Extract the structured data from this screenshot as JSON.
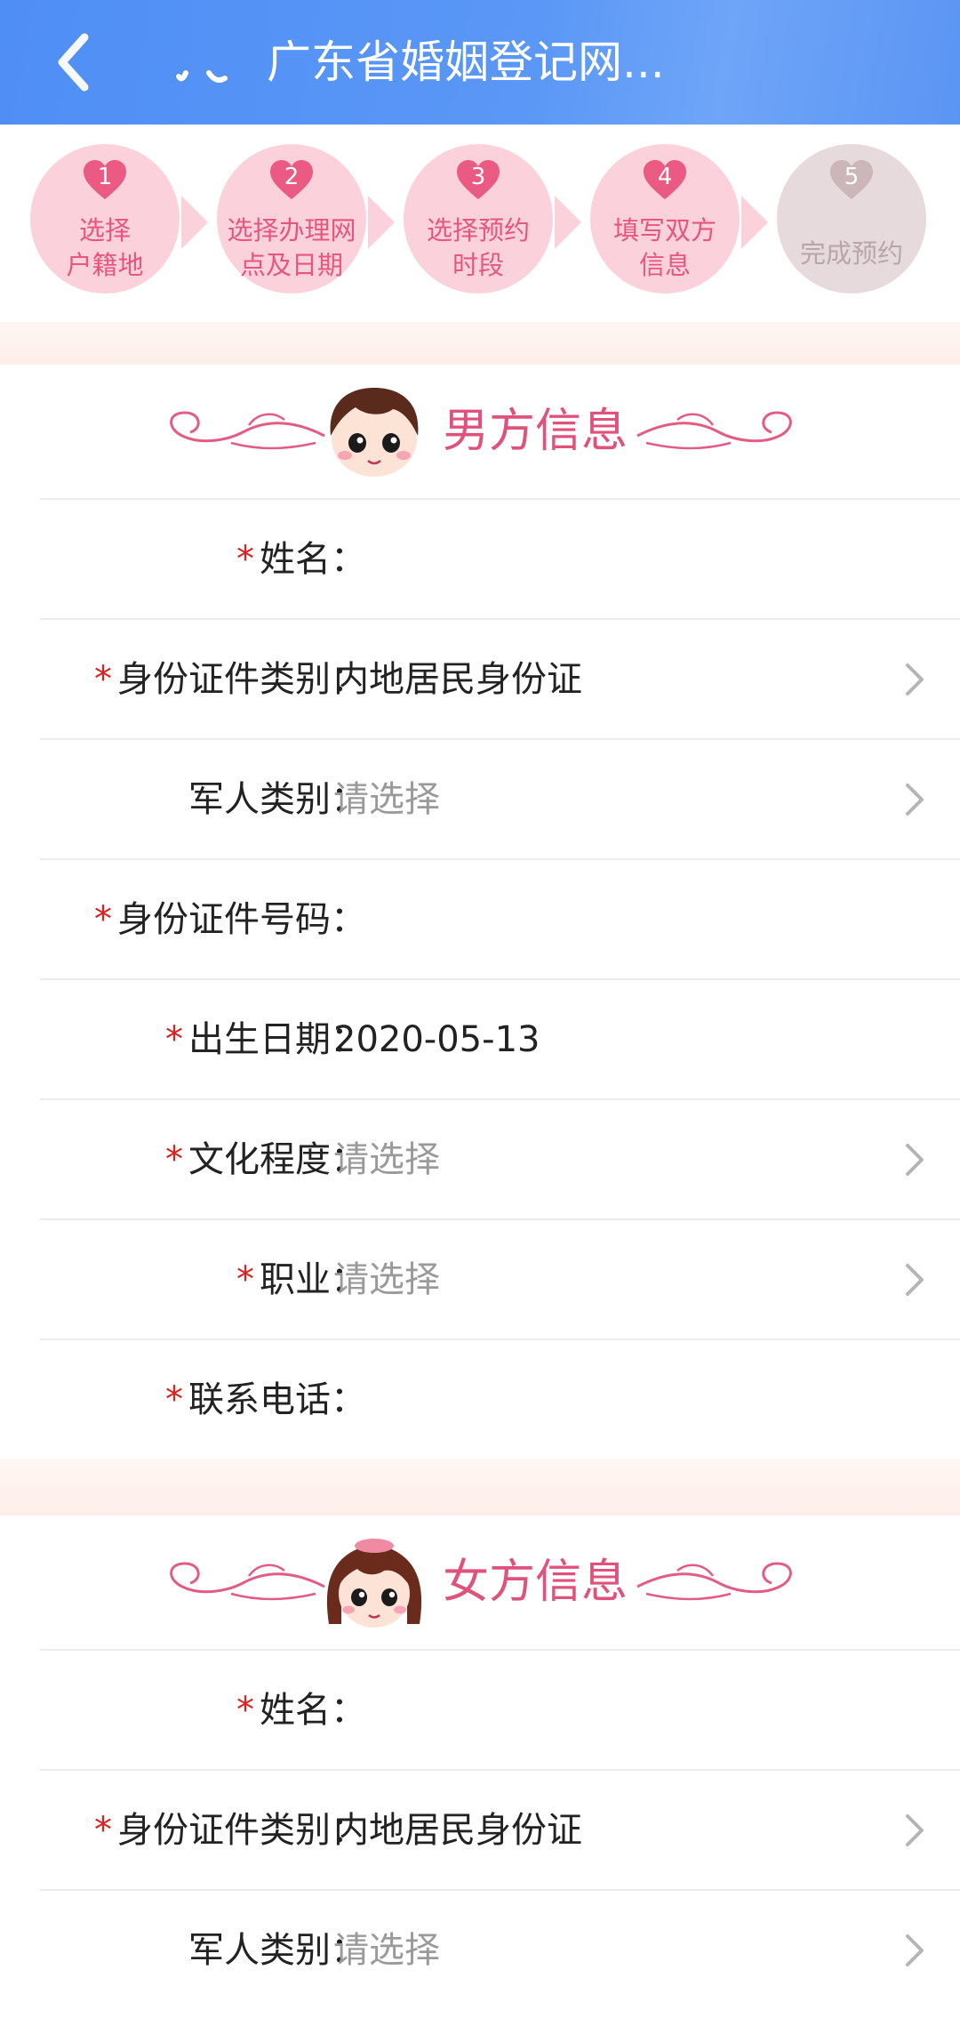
{
  "header": {
    "title": "广东省婚姻登记网...",
    "back_icon": "chevron-left-icon"
  },
  "steps": [
    {
      "num": "1",
      "label": "选择\n户籍地",
      "state": "active"
    },
    {
      "num": "2",
      "label": "选择办理网\n点及日期",
      "state": "active"
    },
    {
      "num": "3",
      "label": "选择预约\n时段",
      "state": "active"
    },
    {
      "num": "4",
      "label": "填写双方\n信息",
      "state": "active"
    },
    {
      "num": "5",
      "label": "完成预约",
      "state": "pending"
    }
  ],
  "male": {
    "title": "男方信息",
    "fields": [
      {
        "label": "姓名：",
        "required": "*",
        "value": ""
      },
      {
        "label": "身份证件类别：",
        "required": "*",
        "value": "内地居民身份证"
      },
      {
        "label": "军人类别：",
        "required": "",
        "value": "请选择"
      },
      {
        "label": "身份证件号码：",
        "required": "*",
        "value": ""
      },
      {
        "label": "出生日期：",
        "required": "*",
        "value": "2020-05-13"
      },
      {
        "label": "文化程度：",
        "required": "*",
        "value": "请选择"
      },
      {
        "label": "职业：",
        "required": "*",
        "value": "请选择"
      },
      {
        "label": "联系电话：",
        "required": "*",
        "value": ""
      }
    ]
  },
  "female": {
    "title": "女方信息",
    "fields": [
      {
        "label": "姓名：",
        "required": "*",
        "value": ""
      },
      {
        "label": "身份证件类别：",
        "required": "*",
        "value": "内地居民身份证"
      },
      {
        "label": "军人类别：",
        "required": "",
        "value": "请选择"
      }
    ]
  },
  "colors": {
    "topbar": "#5a97f6",
    "accent_pink": "#e0527b",
    "required_red": "#e02020"
  }
}
